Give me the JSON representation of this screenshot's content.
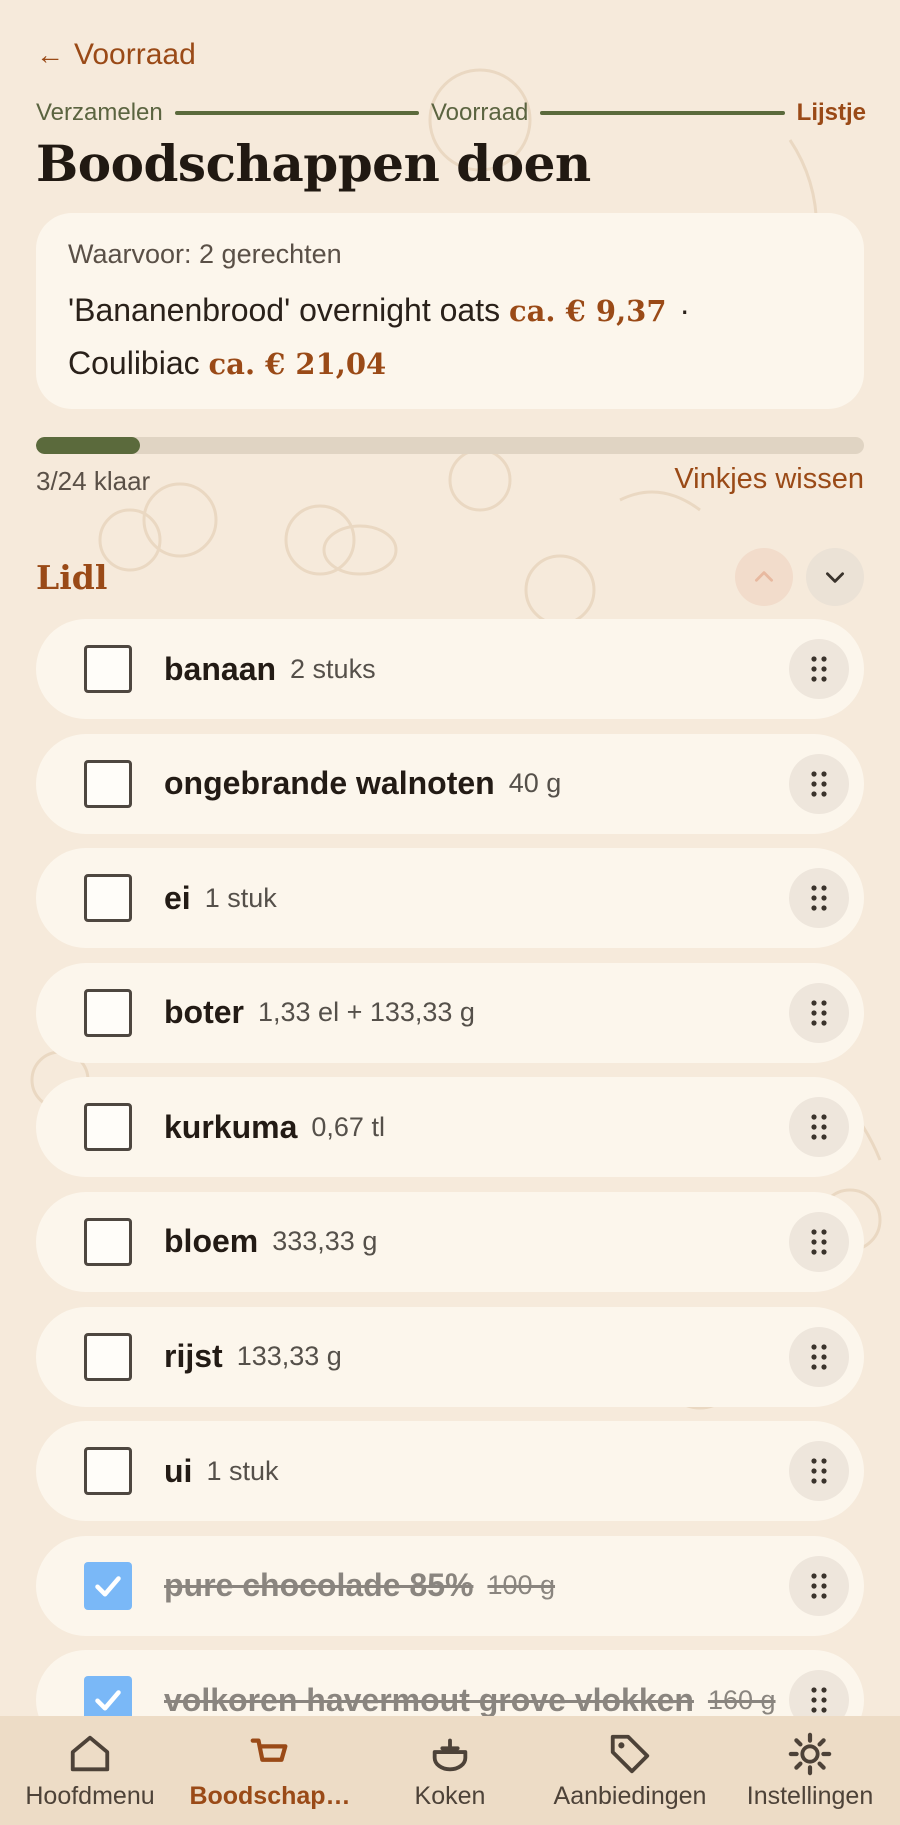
{
  "header": {
    "back_label": "Voorraad",
    "back_icon": "arrow-left-icon",
    "title": "Boodschappen doen"
  },
  "stepper": {
    "steps": [
      "Verzamelen",
      "Voorraad",
      "Lijstje"
    ],
    "active_index": 2
  },
  "summary": {
    "label": "Waarvoor: 2 gerechten",
    "recipes": [
      {
        "name": "'Bananenbrood' overnight oats",
        "price": "ca. € 9,37"
      },
      {
        "name": "Coulibiac",
        "price": "ca. € 21,04"
      }
    ],
    "separator": "·"
  },
  "progress": {
    "done": 3,
    "total": 24,
    "fraction": 0.125,
    "text": "3/24 klaar",
    "clear_label": "Vinkjes wissen"
  },
  "store": {
    "name": "Lidl",
    "up_icon": "chevron-up-icon",
    "down_icon": "chevron-down-icon"
  },
  "items": [
    {
      "name": "banaan",
      "qty": "2 stuks",
      "checked": false
    },
    {
      "name": "ongebrande walnoten",
      "qty": "40 g",
      "checked": false
    },
    {
      "name": "ei",
      "qty": "1 stuk",
      "checked": false
    },
    {
      "name": "boter",
      "qty": "1,33 el + 133,33 g",
      "checked": false
    },
    {
      "name": "kurkuma",
      "qty": "0,67 tl",
      "checked": false
    },
    {
      "name": "bloem",
      "qty": "333,33 g",
      "checked": false
    },
    {
      "name": "rijst",
      "qty": "133,33 g",
      "checked": false
    },
    {
      "name": "ui",
      "qty": "1 stuk",
      "checked": false
    },
    {
      "name": "pure chocolade 85%",
      "qty": "100 g",
      "checked": true
    },
    {
      "name": "volkoren havermout grove vlokken",
      "qty": "160 g",
      "checked": true
    }
  ],
  "nav": [
    {
      "label": "Hoofdmenu",
      "icon": "home-icon",
      "active": false
    },
    {
      "label": "Boodschap…",
      "icon": "shopping-cart-icon",
      "active": true
    },
    {
      "label": "Koken",
      "icon": "cooking-pot-icon",
      "active": false
    },
    {
      "label": "Aanbiedingen",
      "icon": "tag-icon",
      "active": false
    },
    {
      "label": "Instellingen",
      "icon": "gear-icon",
      "active": false
    }
  ],
  "colors": {
    "background": "#f6eadb",
    "accent": "#9a4a17",
    "progress": "#5b6a3c",
    "checkbox_checked": "#7ab8f7"
  }
}
